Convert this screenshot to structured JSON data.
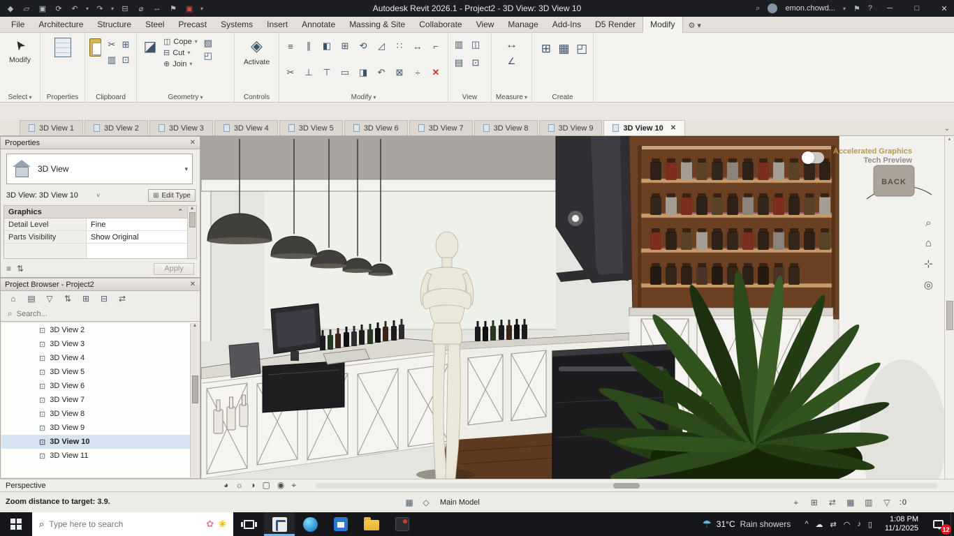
{
  "title_bar": {
    "title": "Autodesk Revit 2026.1 - Project2 - 3D View: 3D View 10",
    "account": "emon.chowd..."
  },
  "ribbon": {
    "tabs": [
      {
        "label": "File"
      },
      {
        "label": "Architecture"
      },
      {
        "label": "Structure"
      },
      {
        "label": "Steel"
      },
      {
        "label": "Precast"
      },
      {
        "label": "Systems"
      },
      {
        "label": "Insert"
      },
      {
        "label": "Annotate"
      },
      {
        "label": "Massing & Site"
      },
      {
        "label": "Collaborate"
      },
      {
        "label": "View"
      },
      {
        "label": "Manage"
      },
      {
        "label": "Add-Ins"
      },
      {
        "label": "D5 Render"
      },
      {
        "label": "Modify"
      }
    ],
    "panels": {
      "select": {
        "label": "Select",
        "button": "Modify"
      },
      "properties": {
        "label": "Properties"
      },
      "clipboard": {
        "label": "Clipboard"
      },
      "geometry": {
        "label": "Geometry",
        "rows": [
          "Cope",
          "Cut",
          "Join"
        ]
      },
      "controls": {
        "label": "Controls",
        "button": "Activate"
      },
      "modify": {
        "label": "Modify"
      },
      "view": {
        "label": "View"
      },
      "measure": {
        "label": "Measure"
      },
      "create": {
        "label": "Create"
      }
    }
  },
  "view_tabs": [
    "3D View 1",
    "3D View 2",
    "3D View 3",
    "3D View 4",
    "3D View 5",
    "3D View 6",
    "3D View 7",
    "3D View 8",
    "3D View 9",
    "3D View 10"
  ],
  "properties_palette": {
    "title": "Properties",
    "type_name": "3D View",
    "instance": "3D View: 3D View 10",
    "edit_type": "Edit Type",
    "group": "Graphics",
    "rows": [
      {
        "param": "Detail Level",
        "value": "Fine"
      },
      {
        "param": "Parts Visibility",
        "value": "Show Original"
      }
    ],
    "apply": "Apply"
  },
  "project_browser": {
    "title": "Project Browser - Project2",
    "search_placeholder": "Search...",
    "items": [
      "3D View 2",
      "3D View 3",
      "3D View 4",
      "3D View 5",
      "3D View 6",
      "3D View 7",
      "3D View 8",
      "3D View 9",
      "3D View 10",
      "3D View 11"
    ],
    "selected_item": "3D View 10"
  },
  "viewport": {
    "overlay": {
      "line1": "Accelerated Graphics",
      "line2": "Tech Preview"
    },
    "scene": {
      "back_sign": "BACK"
    }
  },
  "view_control_bar": {
    "projection": "Perspective"
  },
  "status_bar": {
    "message": "Zoom distance to target: 3.9.",
    "design_option": "Main Model",
    "filter_count": "0"
  },
  "taskbar": {
    "search_placeholder": "Type here to search",
    "weather": {
      "temp": "31°C",
      "condition": "Rain showers"
    },
    "clock": {
      "time": "1:08 PM",
      "date": "11/1/2025"
    },
    "badge": "12"
  }
}
